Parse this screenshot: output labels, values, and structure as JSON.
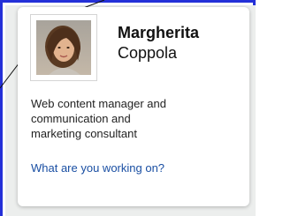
{
  "profile": {
    "first_name": "Margherita",
    "last_name": "Coppola",
    "headline_lines": [
      "Web content manager and",
      "communication and",
      "marketing consultant"
    ],
    "status_prompt": "What are you working on?",
    "photo_icon": "profile-photo"
  },
  "colors": {
    "frame": "#2430d8",
    "panel": "#eceeed",
    "link": "#1a4fa3",
    "text": "#111111"
  }
}
